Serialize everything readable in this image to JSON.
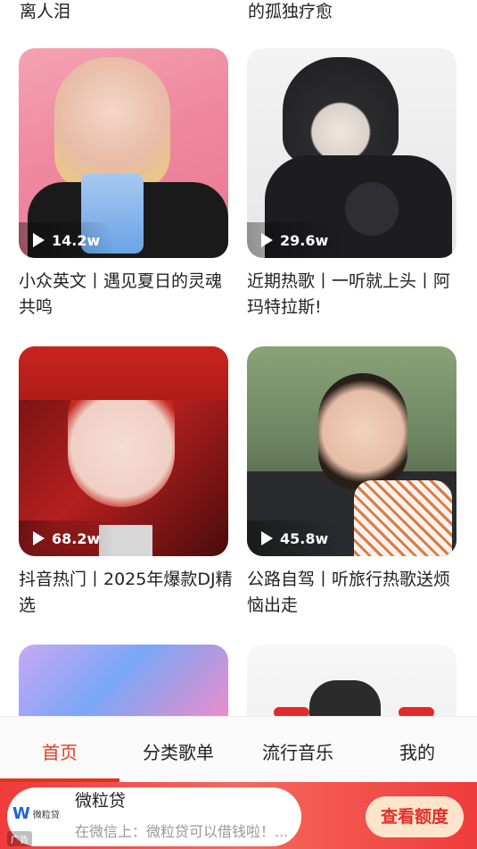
{
  "top_partial": {
    "left": "离人泪",
    "right": "的孤独疗愈"
  },
  "playlists": [
    {
      "plays": "14.2w",
      "title": "小众英文丨遇见夏日的灵魂共鸣"
    },
    {
      "plays": "29.6w",
      "title": "近期热歌丨一听就上头丨阿玛特拉斯!"
    },
    {
      "plays": "68.2w",
      "title": "抖音热门丨2025年爆款DJ精选"
    },
    {
      "plays": "45.8w",
      "title": "公路自驾丨听旅行热歌送烦恼出走"
    }
  ],
  "nav": {
    "tabs": [
      "首页",
      "分类歌单",
      "流行音乐",
      "我的"
    ],
    "active": "首页"
  },
  "ad": {
    "logo_text": "微粒贷",
    "brand": "微粒贷",
    "desc": "在微信上：微粒贷可以借钱啦！...",
    "tag": "广告",
    "cta": "查看额度"
  },
  "colors": {
    "accent": "#e53a23",
    "ad_bg": "#ef3b3b",
    "cta_bg": "#fde4cb"
  }
}
